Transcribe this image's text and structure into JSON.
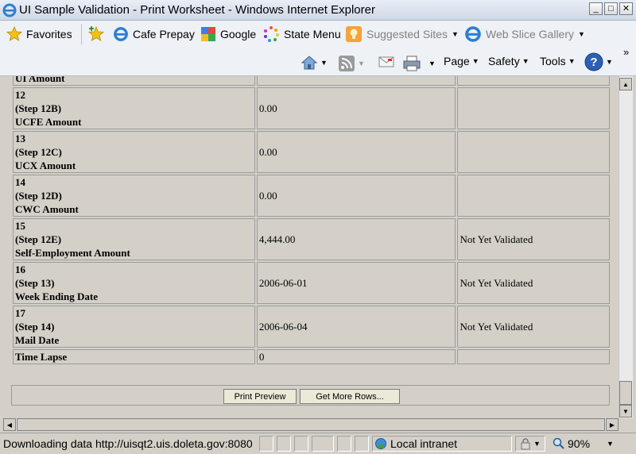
{
  "window": {
    "title": "UI Sample Validation - Print Worksheet - Windows Internet Explorer",
    "minimize_glyph": "_",
    "maximize_glyph": "□",
    "close_glyph": "✕"
  },
  "favorites_bar": {
    "favorites_label": "Favorites",
    "links": [
      {
        "label": "Cafe Prepay",
        "icon": "ie-icon"
      },
      {
        "label": "Google",
        "icon": "google-icon"
      },
      {
        "label": "State Menu",
        "icon": "state-menu-icon"
      },
      {
        "label": "Suggested Sites",
        "icon": "suggested-sites-icon"
      },
      {
        "label": "Web Slice Gallery",
        "icon": "ie-icon"
      }
    ]
  },
  "command_bar": {
    "page_label": "Page",
    "safety_label": "Safety",
    "tools_label": "Tools",
    "overflow_glyph": "»"
  },
  "table": {
    "rows": [
      {
        "lines": [
          "UI Amount"
        ],
        "value": "",
        "status": ""
      },
      {
        "lines": [
          "12",
          "(Step 12B)",
          "UCFE Amount"
        ],
        "value": "0.00",
        "status": ""
      },
      {
        "lines": [
          "13",
          "(Step 12C)",
          "UCX Amount"
        ],
        "value": "0.00",
        "status": ""
      },
      {
        "lines": [
          "14",
          "(Step 12D)",
          "CWC Amount"
        ],
        "value": "0.00",
        "status": ""
      },
      {
        "lines": [
          "15",
          "(Step 12E)",
          "Self-Employment Amount"
        ],
        "value": "4,444.00",
        "status": "Not Yet Validated"
      },
      {
        "lines": [
          "16",
          "(Step 13)",
          "Week Ending Date"
        ],
        "value": "2006-06-01",
        "status": "Not Yet Validated"
      },
      {
        "lines": [
          "17",
          "(Step 14)",
          "Mail Date"
        ],
        "value": "2006-06-04",
        "status": "Not Yet Validated"
      },
      {
        "lines": [
          "Time Lapse"
        ],
        "value": "0",
        "status": ""
      }
    ]
  },
  "buttons": {
    "print_preview": "Print Preview",
    "get_more_rows": "Get More Rows..."
  },
  "status_bar": {
    "text": "Downloading data http://uisqt2.uis.doleta.gov:8080",
    "zone": "Local intranet",
    "zoom": "90%"
  }
}
